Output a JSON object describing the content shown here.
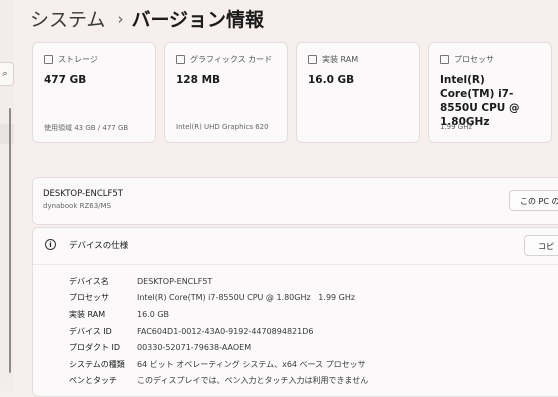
{
  "breadcrumb": {
    "parent": "システム",
    "separator": "›",
    "current": "バージョン情報"
  },
  "cards": [
    {
      "label": "ストレージ",
      "icon": "storage-icon",
      "value": "477 GB",
      "sub": "使用領域 43 GB / 477 GB"
    },
    {
      "label": "グラフィックス カード",
      "icon": "graphics-card-icon",
      "value": "128 MB",
      "sub": "Intel(R) UHD Graphics 620"
    },
    {
      "label": "実装 RAM",
      "icon": "ram-icon",
      "value": "16.0 GB",
      "sub": ""
    },
    {
      "label": "プロセッサ",
      "icon": "processor-icon",
      "value": "Intel(R) Core(TM) i7-8550U CPU @ 1.80GHz",
      "sub": "1.99 GHz"
    }
  ],
  "device": {
    "name": "DESKTOP-ENCLF5T",
    "model": "dynabook RZ63/MS",
    "rename_button": "この PC の名"
  },
  "spec": {
    "title": "デバイスの仕様",
    "copy_button": "コピ",
    "rows": [
      {
        "key": "デバイス名",
        "value": "DESKTOP-ENCLF5T"
      },
      {
        "key": "プロセッサ",
        "value": "Intel(R) Core(TM) i7-8550U CPU @ 1.80GHz   1.99 GHz"
      },
      {
        "key": "実装 RAM",
        "value": "16.0 GB"
      },
      {
        "key": "デバイス ID",
        "value": "FAC604D1-0012-43A0-9192-4470894821D6"
      },
      {
        "key": "プロダクト ID",
        "value": "00330-52071-79638-AAOEM"
      },
      {
        "key": "システムの種類",
        "value": "64 ビット オペレーティング システム、x64 ベース プロセッサ"
      },
      {
        "key": "ペンとタッチ",
        "value": "このディスプレイでは、ペン入力とタッチ入力は利用できません"
      }
    ]
  }
}
